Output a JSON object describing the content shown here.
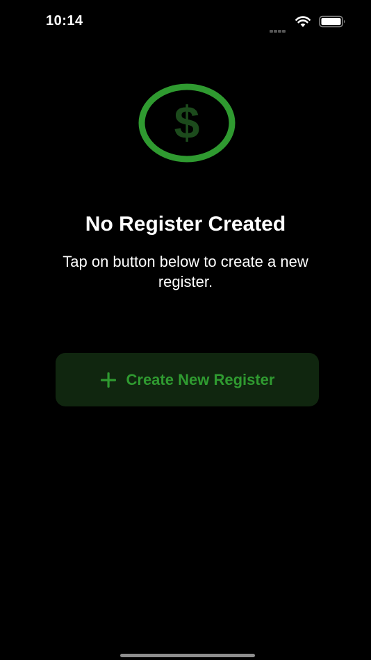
{
  "status_bar": {
    "time": "10:14",
    "icons": [
      "cellular-signal-icon",
      "wifi-icon",
      "battery-icon"
    ]
  },
  "empty_state": {
    "icon": "dollar-circle-icon",
    "title": "No Register Created",
    "subtitle": "Tap on button below to create a new register."
  },
  "actions": {
    "create_label": "Create New Register",
    "create_icon": "plus-icon"
  },
  "colors": {
    "background": "#000000",
    "accent": "#2f9a30",
    "dollar_sign": "#1c4a1c",
    "button_background": "#10260f"
  }
}
